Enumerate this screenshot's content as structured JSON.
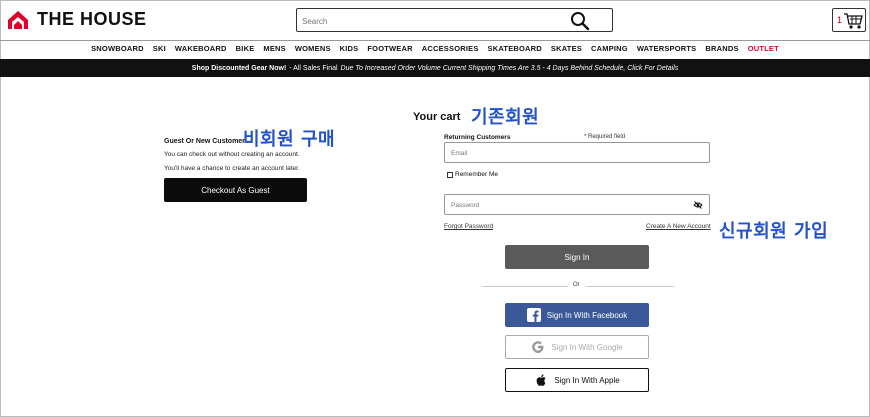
{
  "header": {
    "logo_text": "THE HOUSE",
    "search_placeholder": "Search",
    "cart_count": "1"
  },
  "nav": {
    "items": [
      "SNOWBOARD",
      "SKI",
      "WAKEBOARD",
      "BIKE",
      "MENS",
      "WOMENS",
      "KIDS",
      "FOOTWEAR",
      "ACCESSORIES",
      "SKATEBOARD",
      "SKATES",
      "CAMPING",
      "WATERSPORTS",
      "BRANDS"
    ],
    "outlet": "OUTLET"
  },
  "promo": {
    "bold": "Shop Discounted Gear Now!",
    "normal": "- All Sales Final",
    "italic": "Due To Increased Order Volume Current Shipping Times Are 3.5 - 4 Days Behind Schedule, Click For Details"
  },
  "annotations": {
    "guest": "비회원 구매",
    "existing": "기존회원",
    "signup": "신규회원 가입"
  },
  "guest": {
    "title": "Guest Or New Customer",
    "line1": "You can check out without creating an account.",
    "line2": "You'll have a chance to create an account later.",
    "button": "Checkout As Guest"
  },
  "login": {
    "your_cart": "Your cart",
    "returning": "Returning Customers",
    "required": "* Required field",
    "email_placeholder": "Email",
    "remember": "Remember Me",
    "password_placeholder": "Password",
    "forgot": "Forgot Password",
    "create": "Create A New Account",
    "sign_in": "Sign In",
    "or": "Or",
    "facebook": "Sign In With Facebook",
    "google": "Sign In With Google",
    "apple": "Sign In With Apple"
  },
  "colors": {
    "accent_red": "#e0002a",
    "facebook": "#3b5998",
    "annotation_blue": "#2452c9"
  }
}
